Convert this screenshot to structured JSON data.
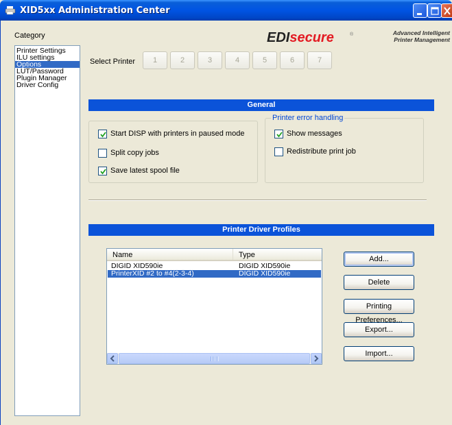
{
  "window": {
    "title": "XID5xx Administration Center"
  },
  "category": {
    "label": "Category",
    "items": [
      "Printer Settings",
      "ILU settings",
      "Options",
      "LUT/Password",
      "Plugin Manager",
      "Driver Config"
    ],
    "selected": "Options"
  },
  "logo": {
    "brand_a": "EDI",
    "brand_b": "secure",
    "reg": "®",
    "tagline_1": "Advanced Intelligent",
    "tagline_2": "Printer Management"
  },
  "select_printer": {
    "label": "Select Printer",
    "buttons": [
      "1",
      "2",
      "3",
      "4",
      "5",
      "6",
      "7"
    ]
  },
  "general": {
    "header": "General",
    "options": [
      {
        "label": "Start DISP with printers in paused mode",
        "checked": true
      },
      {
        "label": "Split copy jobs",
        "checked": false
      },
      {
        "label": "Save latest spool file",
        "checked": true
      }
    ],
    "error_group": {
      "legend": "Printer error handling",
      "options": [
        {
          "label": "Show messages",
          "checked": true
        },
        {
          "label": "Redistribute print job",
          "checked": false
        }
      ]
    }
  },
  "profiles": {
    "header": "Printer Driver Profiles",
    "columns": {
      "name": "Name",
      "type": "Type"
    },
    "rows": [
      {
        "name": "DIGID XID590ie",
        "type": "DIGID XID590ie"
      },
      {
        "name": "PrinterXID #2 to #4(2-3-4)",
        "type": "DIGID XID590ie"
      }
    ],
    "selected_row": 1,
    "buttons": {
      "add": "Add...",
      "delete": "Delete",
      "prefs": "Printing Preferences...",
      "export": "Export...",
      "import": "Import..."
    }
  },
  "colors": {
    "header_blue": "#0b53d9",
    "selection": "#316ac5",
    "brand_red": "#e31b23"
  }
}
